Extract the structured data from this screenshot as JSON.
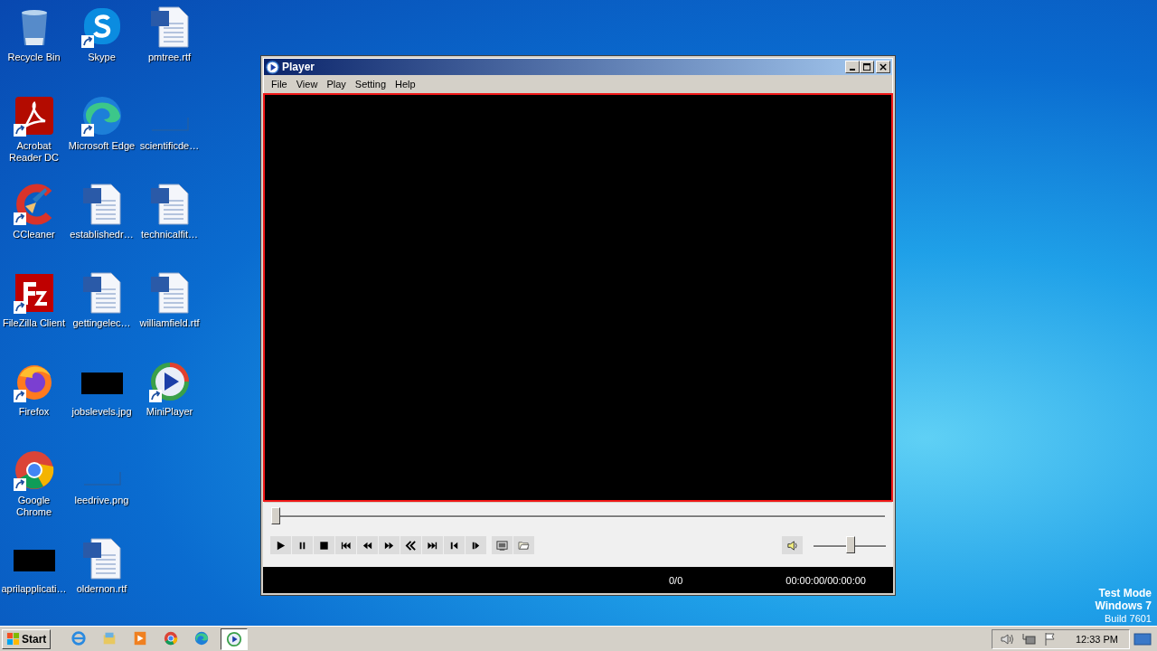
{
  "desktop_icons": [
    {
      "label": "Recycle Bin",
      "kind": "recycle"
    },
    {
      "label": "Acrobat Reader DC",
      "kind": "acrobat"
    },
    {
      "label": "CCleaner",
      "kind": "ccleaner"
    },
    {
      "label": "FileZilla Client",
      "kind": "filezilla"
    },
    {
      "label": "Firefox",
      "kind": "firefox"
    },
    {
      "label": "Google Chrome",
      "kind": "chrome"
    },
    {
      "label": "aprilapplicati…",
      "kind": "dark"
    },
    {
      "label": "Skype",
      "kind": "skype"
    },
    {
      "label": "Microsoft Edge",
      "kind": "edge"
    },
    {
      "label": "establishedr…",
      "kind": "word"
    },
    {
      "label": "gettingelec…",
      "kind": "word"
    },
    {
      "label": "jobslevels.jpg",
      "kind": "dark"
    },
    {
      "label": "leedrive.png",
      "kind": "blank"
    },
    {
      "label": "oldernon.rtf",
      "kind": "word"
    },
    {
      "label": "pmtree.rtf",
      "kind": "word"
    },
    {
      "label": "scientificde…",
      "kind": "blank"
    },
    {
      "label": "technicalfit…",
      "kind": "word"
    },
    {
      "label": "williamfield.rtf",
      "kind": "word"
    },
    {
      "label": "MiniPlayer",
      "kind": "player"
    }
  ],
  "window": {
    "title": "Player",
    "menu": [
      "File",
      "View",
      "Play",
      "Setting",
      "Help"
    ],
    "seek": {
      "level": 0
    },
    "volume": {
      "level": 0.51
    },
    "status": {
      "position": "0/0",
      "time": "00:00:00/00:00:00"
    }
  },
  "watermark_os": [
    "Test Mode",
    "Windows 7",
    "Build 7601"
  ],
  "taskbar": {
    "start": "Start",
    "items": [
      {
        "kind": "ie",
        "selected": false
      },
      {
        "kind": "explorer",
        "selected": false
      },
      {
        "kind": "media",
        "selected": false
      },
      {
        "kind": "chrome",
        "selected": false
      },
      {
        "kind": "edge",
        "selected": false
      },
      {
        "kind": "player",
        "selected": true
      }
    ],
    "clock": "12:33 PM"
  }
}
